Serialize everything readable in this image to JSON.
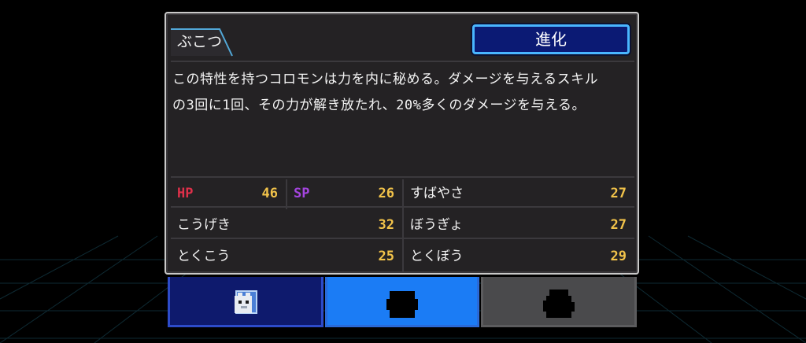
{
  "ability": {
    "name": "ぶこつ",
    "description": "この特性を持つコロモンは力を内に秘める。ダメージを与えるスキル\nの3回に1回、その力が解き放たれ、20%多くのダメージを与える。"
  },
  "evolve_button": {
    "label": "進化"
  },
  "stats": {
    "hp": {
      "label": "HP",
      "value": "46"
    },
    "sp": {
      "label": "SP",
      "value": "26"
    },
    "speed": {
      "label": "すばやさ",
      "value": "27"
    },
    "attack": {
      "label": "こうげき",
      "value": "32"
    },
    "defense": {
      "label": "ぼうぎょ",
      "value": "27"
    },
    "sp_attack": {
      "label": "とくこう",
      "value": "25"
    },
    "sp_defense": {
      "label": "とくぼう",
      "value": "29"
    }
  },
  "tabs": [
    {
      "name": "current-form",
      "state": "unlocked",
      "color": "#0e1a6d"
    },
    {
      "name": "evolution-2",
      "state": "silhouette",
      "color": "#1b7cf5"
    },
    {
      "name": "evolution-3",
      "state": "silhouette",
      "color": "#4a4a4c"
    }
  ],
  "colors": {
    "panel_bg": "#242224",
    "accent_blue": "#49b6ff",
    "stat_value": "#f2c34a",
    "hp_label": "#e0304a",
    "sp_label": "#a545e0"
  }
}
